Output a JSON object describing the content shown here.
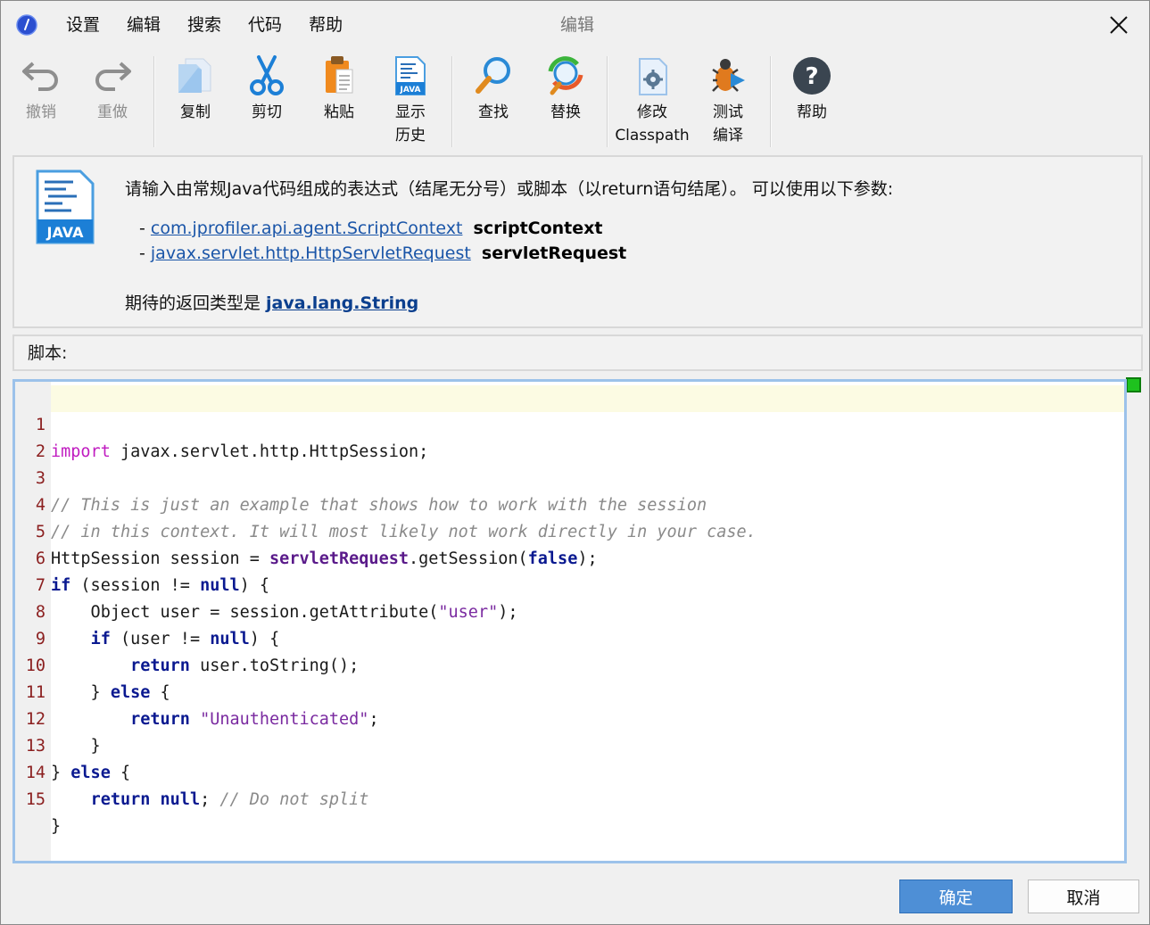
{
  "menu": [
    "设置",
    "编辑",
    "搜索",
    "代码",
    "帮助"
  ],
  "window_title": "编辑",
  "toolbar": {
    "undo": "撤销",
    "redo": "重做",
    "copy": "复制",
    "cut": "剪切",
    "paste": "粘贴",
    "history_line1": "显示",
    "history_line2": "历史",
    "find": "查找",
    "replace": "替换",
    "classpath_line1": "修改",
    "classpath_line2": "Classpath",
    "compile_line1": "测试",
    "compile_line2": "编译",
    "help": "帮助"
  },
  "info": {
    "logo_text": "JAVA",
    "description": "请输入由常规Java代码组成的表达式（结尾无分号）或脚本（以return语句结尾）。 可以使用以下参数:",
    "params": [
      {
        "dash": "- ",
        "type": "com.jprofiler.api.agent.ScriptContext",
        "name": "scriptContext"
      },
      {
        "dash": "- ",
        "type": "javax.servlet.http.HttpServletRequest",
        "name": "servletRequest"
      }
    ],
    "return_prefix": "期待的返回类型是 ",
    "return_type": "java.lang.String"
  },
  "script_label": "脚本:",
  "code_lines": [
    "1",
    "2",
    "3",
    "4",
    "5",
    "6",
    "7",
    "8",
    "9",
    "10",
    "11",
    "12",
    "13",
    "14",
    "15"
  ],
  "code": {
    "l1_kw": "import",
    "l1_rest": " javax.servlet.http.HttpSession;",
    "l3": "// This is just an example that shows how to work with the session",
    "l4": "// in this context. It will most likely not work directly in your case.",
    "l5_a": "HttpSession session = ",
    "l5_var": "servletRequest",
    "l5_b": ".getSession(",
    "l5_kw": "false",
    "l5_c": ");",
    "l6_kw": "if",
    "l6_a": " (session != ",
    "l6_kw2": "null",
    "l6_b": ") {",
    "l7_a": "    Object user = session.getAttribute(",
    "l7_str": "\"user\"",
    "l7_b": ");",
    "l8_a": "    ",
    "l8_kw": "if",
    "l8_b": " (user != ",
    "l8_kw2": "null",
    "l8_c": ") {",
    "l9_a": "        ",
    "l9_kw": "return",
    "l9_b": " user.toString();",
    "l10_a": "    } ",
    "l10_kw": "else",
    "l10_b": " {",
    "l11_a": "        ",
    "l11_kw": "return",
    "l11_b": " ",
    "l11_str": "\"Unauthenticated\"",
    "l11_c": ";",
    "l12": "    }",
    "l13_a": "} ",
    "l13_kw": "else",
    "l13_b": " {",
    "l14_a": "    ",
    "l14_kw": "return",
    "l14_b": " ",
    "l14_kw2": "null",
    "l14_c": "; ",
    "l14_cmt": "// Do not split",
    "l15": "}"
  },
  "buttons": {
    "ok": "确定",
    "cancel": "取消"
  },
  "colors": {
    "ok_button": "#4e8fd6",
    "link": "#1a55a8",
    "editor_border": "#9cc2ea",
    "current_line": "#fcfbe3"
  }
}
